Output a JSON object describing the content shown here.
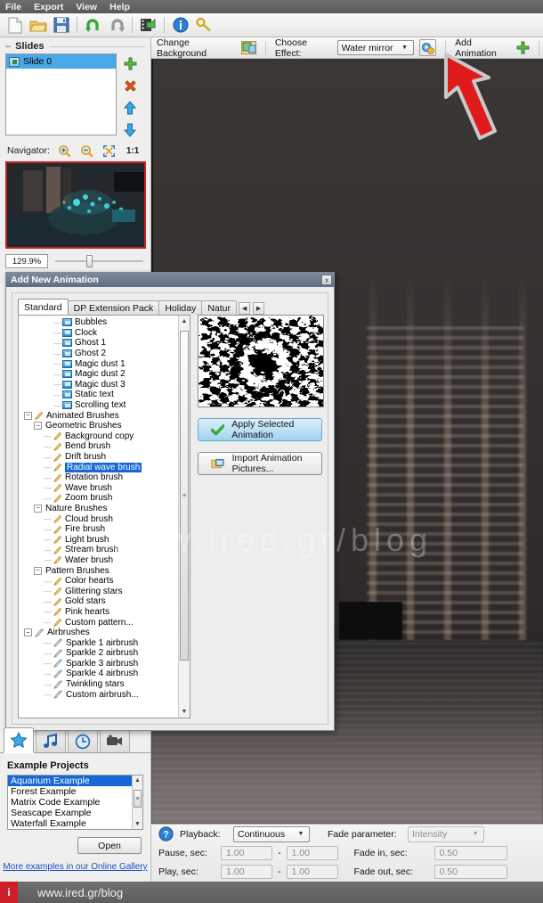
{
  "menubar": {
    "items": [
      "File",
      "Export",
      "View",
      "Help"
    ]
  },
  "toolbar": {
    "buttons": [
      {
        "name": "new-document-icon",
        "title": "New"
      },
      {
        "name": "open-folder-icon",
        "title": "Open"
      },
      {
        "name": "save-icon",
        "title": "Save"
      },
      {
        "name": "undo-icon",
        "title": "Undo"
      },
      {
        "name": "redo-icon",
        "title": "Redo"
      },
      {
        "name": "export-video-icon",
        "title": "Export"
      },
      {
        "name": "info-icon",
        "title": "Info"
      },
      {
        "name": "key-icon",
        "title": "Register"
      }
    ]
  },
  "options_bar": {
    "change_background_label": "Change Background",
    "choose_effect_label": "Choose Effect:",
    "effect_value": "Water mirror",
    "add_animation_label": "Add Animation"
  },
  "slides_panel": {
    "title": "Slides",
    "items": [
      {
        "label": "Slide 0",
        "selected": true
      }
    ],
    "navigator_label": "Navigator:",
    "ratio_label": "1:1",
    "zoom_value": "129.9%"
  },
  "dialog": {
    "title": "Add New Animation",
    "close_label": "x",
    "tabs": [
      {
        "label": "Standard",
        "active": true
      },
      {
        "label": "DP Extension Pack",
        "active": false
      },
      {
        "label": "Holiday",
        "active": false
      },
      {
        "label": "Natur",
        "active": false
      }
    ],
    "tree": [
      {
        "label": "Bubbles",
        "depth": 3,
        "kind": "anim",
        "selected": false
      },
      {
        "label": "Clock",
        "depth": 3,
        "kind": "anim",
        "selected": false
      },
      {
        "label": "Ghost 1",
        "depth": 3,
        "kind": "anim",
        "selected": false
      },
      {
        "label": "Ghost 2",
        "depth": 3,
        "kind": "anim",
        "selected": false
      },
      {
        "label": "Magic dust 1",
        "depth": 3,
        "kind": "anim",
        "selected": false
      },
      {
        "label": "Magic dust 2",
        "depth": 3,
        "kind": "anim",
        "selected": false
      },
      {
        "label": "Magic dust 3",
        "depth": 3,
        "kind": "anim",
        "selected": false
      },
      {
        "label": "Static text",
        "depth": 3,
        "kind": "anim",
        "selected": false
      },
      {
        "label": "Scrolling text",
        "depth": 3,
        "kind": "anim",
        "selected": false
      },
      {
        "label": "Animated Brushes",
        "depth": 0,
        "kind": "group-brush",
        "selected": false
      },
      {
        "label": "Geometric Brushes",
        "depth": 1,
        "kind": "group",
        "selected": false
      },
      {
        "label": "Background copy",
        "depth": 2,
        "kind": "brush",
        "selected": false
      },
      {
        "label": "Bend brush",
        "depth": 2,
        "kind": "brush",
        "selected": false
      },
      {
        "label": "Drift brush",
        "depth": 2,
        "kind": "brush",
        "selected": false
      },
      {
        "label": "Radial wave brush",
        "depth": 2,
        "kind": "brush",
        "selected": true
      },
      {
        "label": "Rotation brush",
        "depth": 2,
        "kind": "brush",
        "selected": false
      },
      {
        "label": "Wave brush",
        "depth": 2,
        "kind": "brush",
        "selected": false
      },
      {
        "label": "Zoom brush",
        "depth": 2,
        "kind": "brush",
        "selected": false
      },
      {
        "label": "Nature Brushes",
        "depth": 1,
        "kind": "group",
        "selected": false
      },
      {
        "label": "Cloud brush",
        "depth": 2,
        "kind": "brush",
        "selected": false
      },
      {
        "label": "Fire brush",
        "depth": 2,
        "kind": "brush",
        "selected": false
      },
      {
        "label": "Light brush",
        "depth": 2,
        "kind": "brush",
        "selected": false
      },
      {
        "label": "Stream brush",
        "depth": 2,
        "kind": "brush",
        "selected": false
      },
      {
        "label": "Water brush",
        "depth": 2,
        "kind": "brush",
        "selected": false
      },
      {
        "label": "Pattern Brushes",
        "depth": 1,
        "kind": "group",
        "selected": false
      },
      {
        "label": "Color hearts",
        "depth": 2,
        "kind": "brush",
        "selected": false
      },
      {
        "label": "Glittering stars",
        "depth": 2,
        "kind": "brush",
        "selected": false
      },
      {
        "label": "Gold stars",
        "depth": 2,
        "kind": "brush",
        "selected": false
      },
      {
        "label": "Pink hearts",
        "depth": 2,
        "kind": "brush",
        "selected": false
      },
      {
        "label": "Custom pattern...",
        "depth": 2,
        "kind": "brush",
        "selected": false
      },
      {
        "label": "Airbrushes",
        "depth": 0,
        "kind": "group-air",
        "selected": false
      },
      {
        "label": "Sparkle 1 airbrush",
        "depth": 2,
        "kind": "air",
        "selected": false
      },
      {
        "label": "Sparkle 2 airbrush",
        "depth": 2,
        "kind": "air",
        "selected": false
      },
      {
        "label": "Sparkle 3 airbrush",
        "depth": 2,
        "kind": "air",
        "selected": false
      },
      {
        "label": "Sparkle 4 airbrush",
        "depth": 2,
        "kind": "air",
        "selected": false
      },
      {
        "label": "Twinkling stars",
        "depth": 2,
        "kind": "air",
        "selected": false
      },
      {
        "label": "Custom airbrush...",
        "depth": 2,
        "kind": "air",
        "selected": false
      }
    ],
    "apply_button": "Apply Selected Animation",
    "import_button": "Import Animation Pictures..."
  },
  "examples_panel": {
    "tabs": [
      {
        "name": "star-icon",
        "active": true
      },
      {
        "name": "music-note-icon",
        "active": false
      },
      {
        "name": "clock-icon",
        "active": false
      },
      {
        "name": "video-camera-icon",
        "active": false
      }
    ],
    "title": "Example Projects",
    "items": [
      {
        "label": "Aquarium Example",
        "selected": true
      },
      {
        "label": "Forest Example",
        "selected": false
      },
      {
        "label": "Matrix Code Example",
        "selected": false
      },
      {
        "label": "Seascape Example",
        "selected": false
      },
      {
        "label": "Waterfall Example",
        "selected": false
      }
    ],
    "open_button": "Open",
    "gallery_link": "More examples in our Online Gallery"
  },
  "playback_panel": {
    "playback_label": "Playback:",
    "playback_value": "Continuous",
    "fade_parameter_label": "Fade parameter:",
    "fade_parameter_value": "Intensity",
    "pause_label": "Pause, sec:",
    "pause_from": "1.00",
    "pause_to": "1.00",
    "play_label": "Play, sec:",
    "play_from": "1.00",
    "play_to": "1.00",
    "fade_in_label": "Fade in, sec:",
    "fade_in_value": "0.50",
    "fade_out_label": "Fade out, sec:",
    "fade_out_value": "0.50",
    "dash": "-"
  },
  "watermark": {
    "text": "www.ired.gr/blog"
  },
  "statusbar": {
    "logo": "i",
    "text": "www.ired.gr/blog"
  },
  "colors": {
    "accent_blue": "#1668d6",
    "selection_blue": "#4aa8e8",
    "brand_red": "#cc2026",
    "annotation_red": "#e01b1b"
  }
}
